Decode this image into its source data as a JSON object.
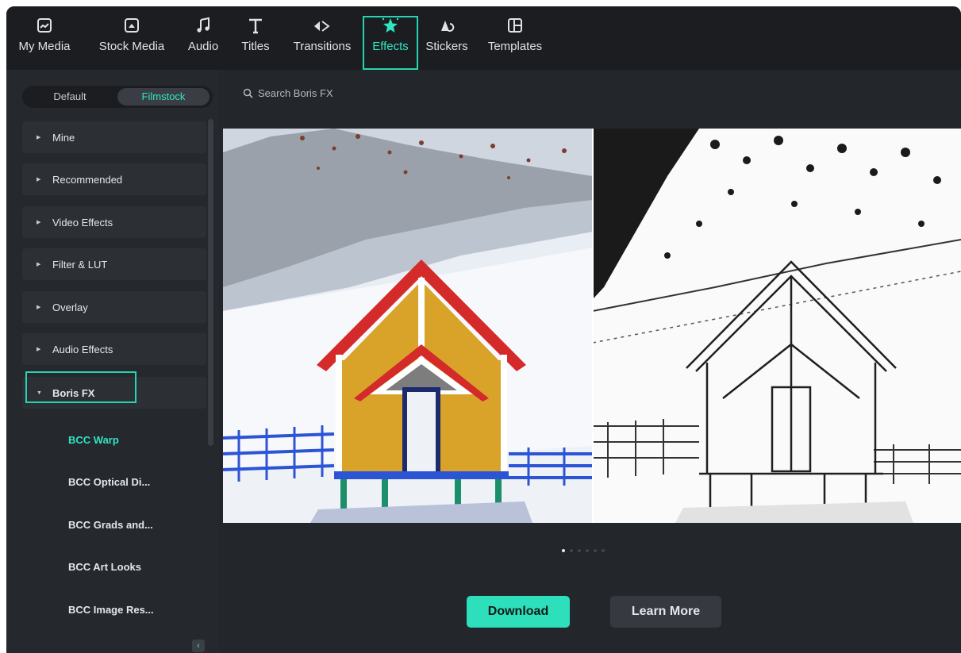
{
  "toolbar": {
    "tabs": [
      {
        "label": "My Media",
        "icon": "my-media-icon"
      },
      {
        "label": "Stock Media",
        "icon": "stock-media-icon"
      },
      {
        "label": "Audio",
        "icon": "audio-icon"
      },
      {
        "label": "Titles",
        "icon": "titles-icon"
      },
      {
        "label": "Transitions",
        "icon": "transitions-icon"
      },
      {
        "label": "Effects",
        "icon": "effects-icon",
        "active": true
      },
      {
        "label": "Stickers",
        "icon": "stickers-icon"
      },
      {
        "label": "Templates",
        "icon": "templates-icon"
      }
    ]
  },
  "sidebar": {
    "segment": {
      "default_label": "Default",
      "filmstock_label": "Filmstock",
      "selected": "Filmstock"
    },
    "categories": [
      {
        "label": "Mine"
      },
      {
        "label": "Recommended"
      },
      {
        "label": "Video Effects"
      },
      {
        "label": "Filter & LUT"
      },
      {
        "label": "Overlay"
      },
      {
        "label": "Audio Effects"
      },
      {
        "label": "Boris FX",
        "expanded": true
      }
    ],
    "boris_items": [
      {
        "label": "BCC Warp",
        "active": true
      },
      {
        "label": "BCC Optical Di..."
      },
      {
        "label": "BCC Grads and..."
      },
      {
        "label": "BCC Art Looks"
      },
      {
        "label": "BCC Image Res..."
      }
    ],
    "collapse_glyph": "‹"
  },
  "main": {
    "search": {
      "placeholder": "Search Boris FX"
    },
    "carousel": {
      "total": 6,
      "current": 1
    },
    "buttons": {
      "download": "Download",
      "learn_more": "Learn More"
    }
  },
  "colors": {
    "accent": "#2fe6c2",
    "highlight_box": "#27d3b1",
    "panel_bg": "#23262b",
    "toolbar_bg": "#1b1d21",
    "download_bg": "#2de0bb"
  }
}
